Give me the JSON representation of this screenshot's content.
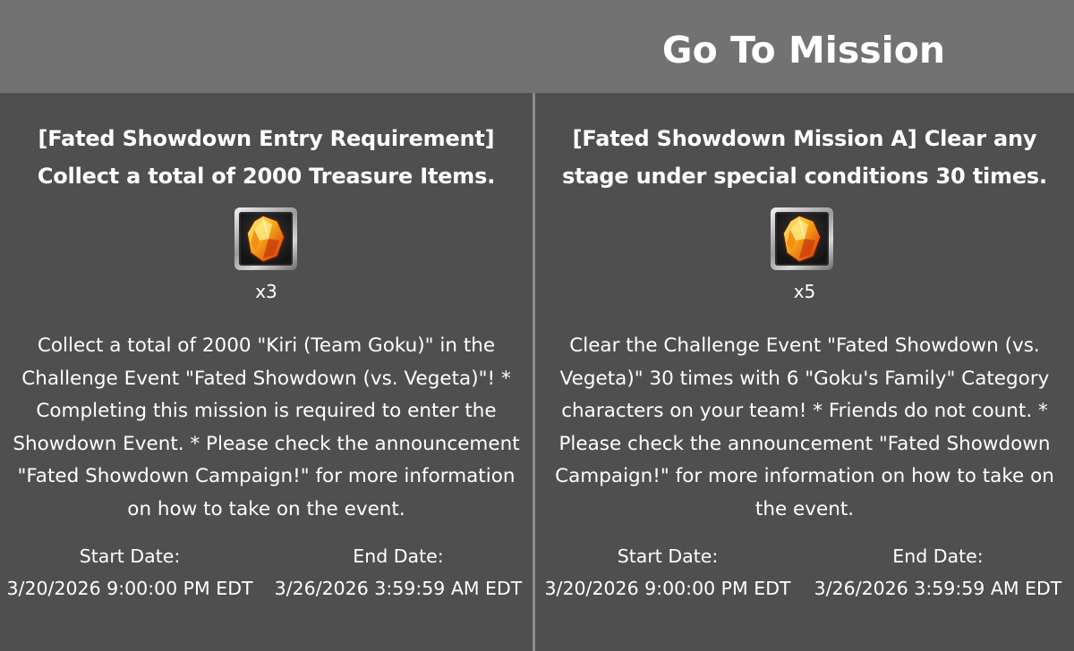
{
  "header": {
    "go_to_mission": "Go To Mission"
  },
  "missions": [
    {
      "title": "[Fated Showdown Entry Requirement] Collect a total of 2000 Treasure Items.",
      "reward_icon": "orange-crystal-icon",
      "reward_qty": "x3",
      "description": "Collect a total of 2000 \"Kiri (Team Goku)\" in the Challenge Event \"Fated Showdown (vs. Vegeta)\"! * Completing this mission is required to enter the Showdown Event. * Please check the announcement \"Fated Showdown Campaign!\" for more information on how to take on the event.",
      "start_label": "Start Date:",
      "start_value": "3/20/2026 9:00:00 PM EDT",
      "end_label": "End Date:",
      "end_value": "3/26/2026 3:59:59 AM EDT"
    },
    {
      "title": "[Fated Showdown Mission A] Clear any stage under special conditions 30 times.",
      "reward_icon": "orange-crystal-icon",
      "reward_qty": "x5",
      "description": "Clear the Challenge Event \"Fated Showdown (vs. Vegeta)\" 30 times with 6 \"Goku's Family\" Category characters on your team! * Friends do not count. * Please check the announcement \"Fated Showdown Campaign!\" for more information on how to take on the event.",
      "start_label": "Start Date:",
      "start_value": "3/20/2026 9:00:00 PM EDT",
      "end_label": "End Date:",
      "end_value": "3/26/2026 3:59:59 AM EDT"
    }
  ],
  "colors": {
    "background": "#4f4f4f",
    "header": "#727272",
    "divider": "#8c8c8c",
    "text": "#ffffff",
    "crystal": "#f7a11a"
  }
}
